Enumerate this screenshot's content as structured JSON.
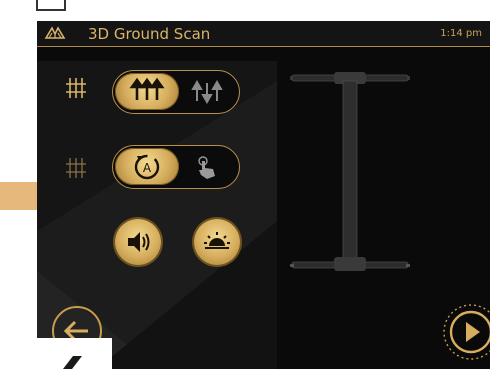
{
  "app": {
    "title": "3D Ground Scan",
    "time": "1:14 pm"
  },
  "icons": {
    "logo": "wing-logo-icon",
    "grid_parallel": "grid-parallel-icon",
    "grid_zigzag": "grid-zigzag-icon",
    "parallel_arrows": "parallel-arrows-icon",
    "alternating_arrows": "alternating-arrows-icon",
    "auto_timer": "auto-timer-icon",
    "manual_touch": "manual-touch-icon",
    "sound": "speaker-icon",
    "brightness": "sunrise-icon",
    "back": "arrow-left-icon",
    "next": "play-icon"
  },
  "controls": {
    "scan_mode": {
      "selected": "parallel"
    },
    "trigger_mode": {
      "selected": "auto"
    }
  },
  "colors": {
    "accent": "#d6ae5e",
    "title_text": "#d9b46a",
    "background": "#0a0a0a"
  }
}
